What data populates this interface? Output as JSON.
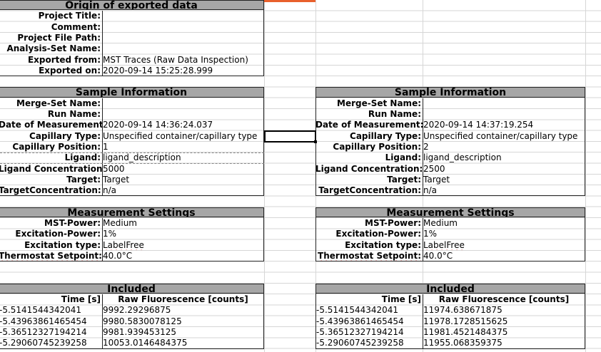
{
  "origin": {
    "header": "Origin of exported data",
    "rows": [
      {
        "label": "Project Title:",
        "value": ""
      },
      {
        "label": "Comment:",
        "value": ""
      },
      {
        "label": "Project File Path:",
        "value": ""
      },
      {
        "label": "Analysis-Set Name:",
        "value": ""
      },
      {
        "label": "Exported from:",
        "value": "MST Traces (Raw Data Inspection)"
      },
      {
        "label": "Exported on:",
        "value": "2020-09-14 15:25:28.999"
      }
    ]
  },
  "left": {
    "sample_header": "Sample Information",
    "sample_rows": [
      {
        "label": "Merge-Set Name:",
        "value": ""
      },
      {
        "label": "Run Name:",
        "value": ""
      },
      {
        "label": "Date of Measurement:",
        "value": "2020-09-14 14:36:24.037"
      },
      {
        "label": "Capillary Type:",
        "value": "Unspecified container/capillary type"
      },
      {
        "label": "Capillary Position:",
        "value": "1"
      },
      {
        "label": "Ligand:",
        "value": "ligand_description"
      },
      {
        "label": "Ligand Concentration:",
        "value": "5000"
      },
      {
        "label": "Target:",
        "value": "Target"
      },
      {
        "label": "TargetConcentration:",
        "value": "n/a"
      }
    ],
    "settings_header": "Measurement Settings",
    "settings_rows": [
      {
        "label": "MST-Power:",
        "value": "Medium"
      },
      {
        "label": "Excitation-Power:",
        "value": "1%"
      },
      {
        "label": "Excitation type:",
        "value": "LabelFree"
      },
      {
        "label": "Thermostat Setpoint:",
        "value": "40.0°C"
      }
    ],
    "included_header": "Included",
    "col_time": "Time [s]",
    "col_fluor": "Raw Fluorescence [counts]",
    "data": [
      {
        "time": "-5.5141544342041",
        "fluor": "9992.29296875"
      },
      {
        "time": "-5.43963861465454",
        "fluor": "9980.5830078125"
      },
      {
        "time": "-5.36512327194214",
        "fluor": "9981.939453125"
      },
      {
        "time": "-5.29060745239258",
        "fluor": "10053.0146484375"
      }
    ]
  },
  "right": {
    "sample_header": "Sample Information",
    "sample_rows": [
      {
        "label": "Merge-Set Name:",
        "value": ""
      },
      {
        "label": "Run Name:",
        "value": ""
      },
      {
        "label": "Date of Measurement:",
        "value": "2020-09-14 14:37:19.254"
      },
      {
        "label": "Capillary Type:",
        "value": "Unspecified container/capillary type"
      },
      {
        "label": "Capillary Position:",
        "value": "2"
      },
      {
        "label": "Ligand:",
        "value": "ligand_description"
      },
      {
        "label": "Ligand Concentration:",
        "value": "2500"
      },
      {
        "label": "Target:",
        "value": "Target"
      },
      {
        "label": "TargetConcentration:",
        "value": "n/a"
      }
    ],
    "settings_header": "Measurement Settings",
    "settings_rows": [
      {
        "label": "MST-Power:",
        "value": "Medium"
      },
      {
        "label": "Excitation-Power:",
        "value": "1%"
      },
      {
        "label": "Excitation type:",
        "value": "LabelFree"
      },
      {
        "label": "Thermostat Setpoint:",
        "value": "40.0°C"
      }
    ],
    "included_header": "Included",
    "col_time": "Time [s]",
    "col_fluor": "Raw Fluorescence [counts]",
    "data": [
      {
        "time": "-5.5141544342041",
        "fluor": "11974.638671875"
      },
      {
        "time": "-5.43963861465454",
        "fluor": "11978.1728515625"
      },
      {
        "time": "-5.36512327194214",
        "fluor": "11981.4521484375"
      },
      {
        "time": "-5.29060745239258",
        "fluor": "11955.068359375"
      }
    ]
  }
}
